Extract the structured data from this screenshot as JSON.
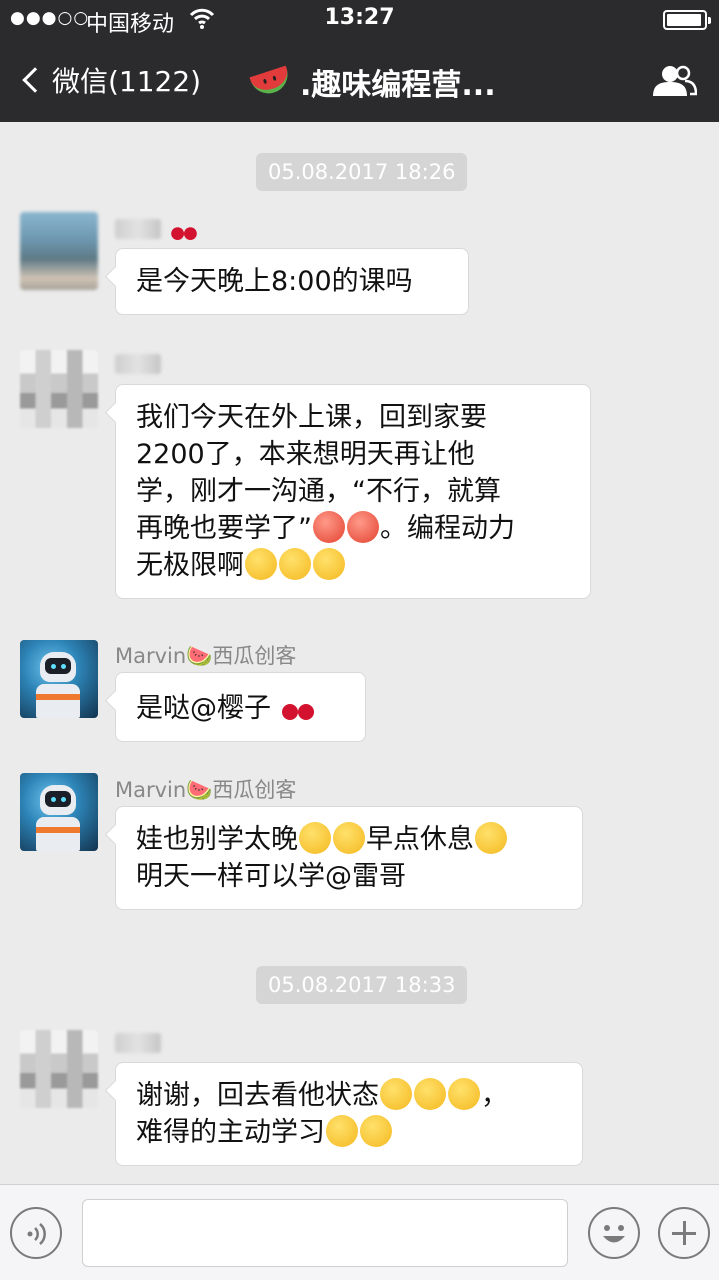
{
  "status_bar": {
    "signal": "●●●○○",
    "carrier": "中国移动",
    "time": "13:27"
  },
  "nav": {
    "back_label": "微信(1122)",
    "title": ".趣味编程营...",
    "title_emoji": "watermelon-icon",
    "right_icon": "group-members-icon"
  },
  "chat": {
    "timestamps": [
      "05.08.2017 18:26",
      "05.08.2017 18:33"
    ],
    "messages": [
      {
        "sender": "",
        "avatar": "blurred-photo",
        "text": "是今天晚上8:00的课吗"
      },
      {
        "sender": "",
        "avatar": "blurred-photo",
        "lines": [
          "我们今天在外上课，回到家要",
          "2200了，本来想明天再让他",
          "学，刚才一沟通，“不行，就算",
          "再晚也要学了”",
          "。编程动力",
          "无极限啊"
        ]
      },
      {
        "sender": "Marvin🍉西瓜创客",
        "avatar": "robot",
        "text": "是哒@樱子 "
      },
      {
        "sender": "Marvin🍉西瓜创客",
        "avatar": "robot",
        "lines": [
          "娃也别学太晚",
          "早点休息",
          "明天一样可以学@雷哥"
        ]
      },
      {
        "sender": "",
        "avatar": "blurred-photo",
        "lines": [
          "谢谢，回去看他状态",
          "，",
          "难得的主动学习"
        ]
      }
    ]
  },
  "input_bar": {
    "voice_icon": "voice-icon",
    "emoji_icon": "emoji-icon",
    "plus_icon": "plus-icon"
  }
}
